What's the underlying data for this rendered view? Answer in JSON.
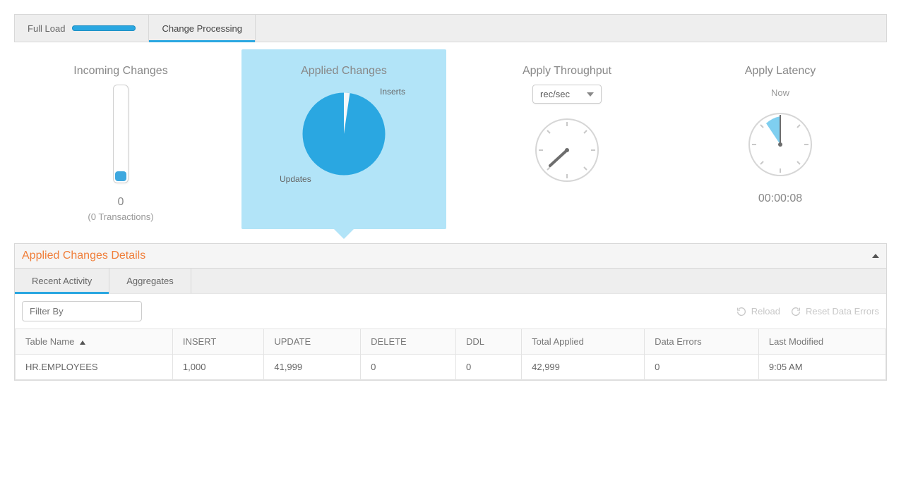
{
  "tabs": {
    "full_load": "Full Load",
    "change_processing": "Change Processing"
  },
  "cards": {
    "incoming": {
      "title": "Incoming Changes",
      "value": "0",
      "sub": "(0 Transactions)"
    },
    "applied": {
      "title": "Applied Changes",
      "label_inserts": "Inserts",
      "label_updates": "Updates"
    },
    "throughput": {
      "title": "Apply Throughput",
      "unit_selected": "rec/sec"
    },
    "latency": {
      "title": "Apply Latency",
      "sub": "Now",
      "value": "00:00:08"
    }
  },
  "details": {
    "title": "Applied Changes Details",
    "subtabs": {
      "recent": "Recent Activity",
      "aggregates": "Aggregates"
    },
    "filter_placeholder": "Filter By",
    "reload": "Reload",
    "reset": "Reset Data Errors",
    "columns": {
      "table_name": "Table Name",
      "insert": "INSERT",
      "update": "UPDATE",
      "delete": "DELETE",
      "ddl": "DDL",
      "total": "Total Applied",
      "errors": "Data Errors",
      "modified": "Last Modified"
    },
    "rows": [
      {
        "table_name": "HR.EMPLOYEES",
        "insert": "1,000",
        "update": "41,999",
        "delete": "0",
        "ddl": "0",
        "total": "42,999",
        "errors": "0",
        "modified": "9:05 AM"
      }
    ]
  },
  "chart_data": {
    "type": "pie",
    "title": "Applied Changes",
    "series": [
      {
        "name": "Inserts",
        "value": 1000
      },
      {
        "name": "Updates",
        "value": 41999
      }
    ]
  }
}
